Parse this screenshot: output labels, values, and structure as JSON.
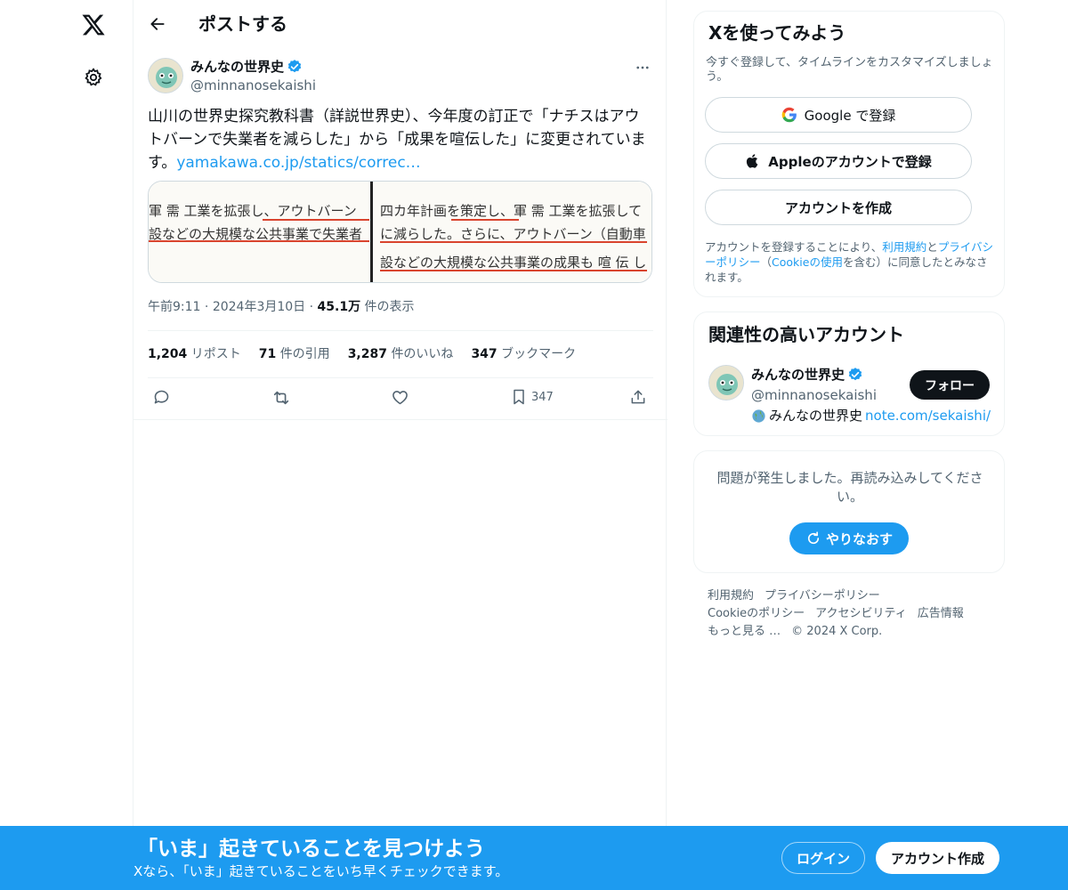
{
  "header": {
    "title": "ポストする"
  },
  "post": {
    "author_name": "みんなの世界史",
    "author_handle": "@minnanosekaishi",
    "text": "山川の世界史探究教科書（詳説世界史）、今年度の訂正で「ナチスはアウトバーンで失業者を減らした」から「成果を喧伝した」に変更されています。",
    "link_text": "yamakawa.co.jp/statics/correc…",
    "media": {
      "left_lines": [
        "軍 需 工業を拡張し、アウトバーン",
        "設などの大規模な公共事業で失業者"
      ],
      "right_lines": [
        "四カ年計画を策定し、軍 需 工業を拡張して",
        "に減らした。さらに、アウトバーン（自動車",
        "設などの大規模な公共事業の成果も 喧 伝 し"
      ]
    },
    "time": "午前9:11",
    "date": "2024年3月10日",
    "views_count": "45.1万",
    "views_label": "件の表示",
    "stats": {
      "reposts_count": "1,204",
      "reposts_label": "リポスト",
      "quotes_count": "71",
      "quotes_label": "件の引用",
      "likes_count": "3,287",
      "likes_label": "件のいいね",
      "bookmarks_count": "347",
      "bookmarks_label": "ブックマーク"
    },
    "actions": {
      "bookmark_count": "347"
    }
  },
  "signup": {
    "title": "Xを使ってみよう",
    "subtitle": "今すぐ登録して、タイムラインをカスタマイズしましょう。",
    "google_label": "Google で登録",
    "apple_label": "Appleのアカウントで登録",
    "create_label": "アカウントを作成",
    "terms_prefix": "アカウントを登録することにより、",
    "terms_link": "利用規約",
    "terms_and": "と",
    "privacy_link": "プライバシーポリシー",
    "cookie_open": "（",
    "cookie_link": "Cookieの使用",
    "cookie_suffix": "を含む）に同意したとみなされます。"
  },
  "related": {
    "title": "関連性の高いアカウント",
    "name": "みんなの世界史",
    "handle": "@minnanosekaishi",
    "bio_text": "みんなの世界史",
    "bio_link": "note.com/sekaishi/",
    "follow_label": "フォロー"
  },
  "error_card": {
    "message": "問題が発生しました。再読み込みしてください。",
    "retry_label": "やりなおす"
  },
  "footer": {
    "terms": "利用規約",
    "privacy": "プライバシーポリシー",
    "cookie": "Cookieのポリシー",
    "accessibility": "アクセシビリティ",
    "ads": "広告情報",
    "more": "もっと見る …",
    "copyright": "© 2024 X Corp."
  },
  "bottom_bar": {
    "title": "「いま」起きていることを見つけよう",
    "subtitle": "Xなら、「いま」起きていることをいち早くチェックできます。",
    "login_label": "ログイン",
    "signup_label": "アカウント作成"
  },
  "colors": {
    "accent": "#1d9bf0",
    "text": "#0f1419",
    "muted": "#536471"
  },
  "icons": [
    "x-logo-icon",
    "gear-icon",
    "back-arrow-icon",
    "verified-badge-icon",
    "more-icon",
    "reply-icon",
    "repost-icon",
    "like-icon",
    "bookmark-icon",
    "share-icon",
    "google-icon",
    "apple-icon",
    "globe-icon",
    "refresh-icon"
  ]
}
